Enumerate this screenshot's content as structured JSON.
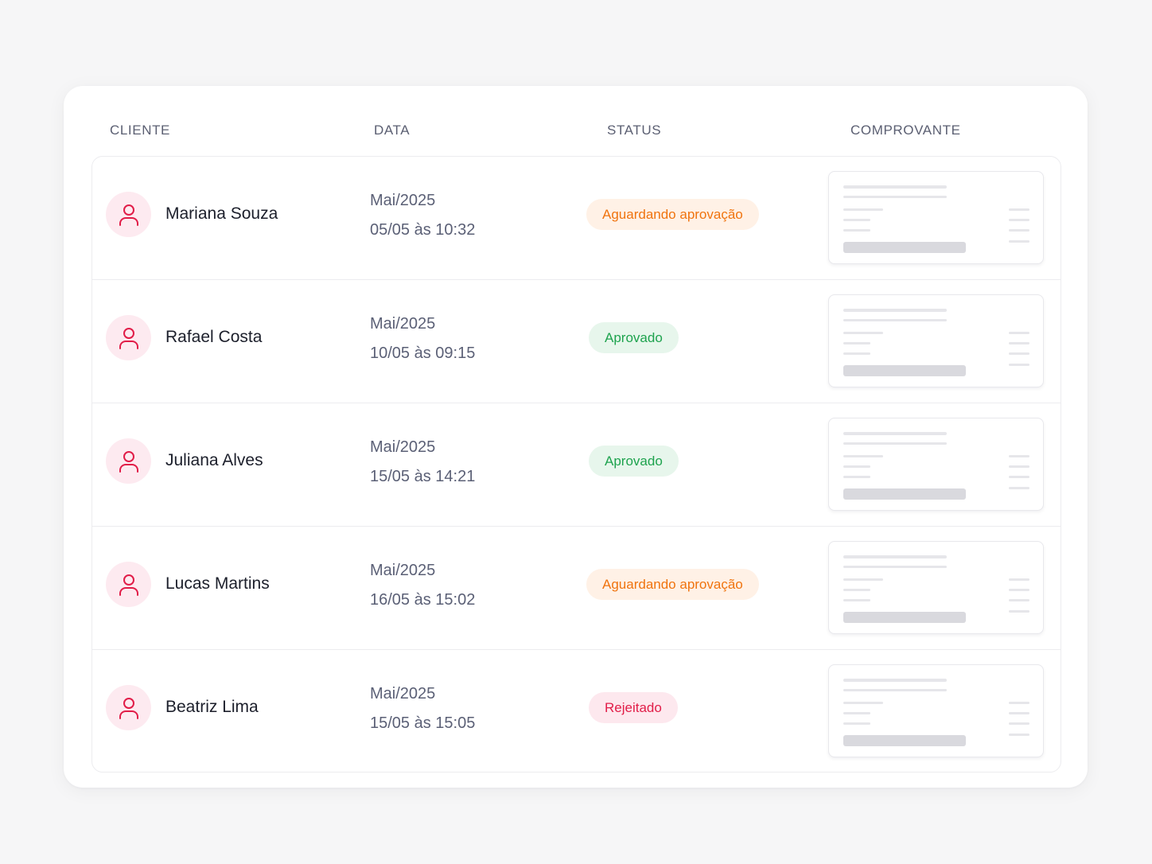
{
  "colors": {
    "accent": "#e11d48",
    "avatar_bg": "#fdeaf0",
    "pending": "#f0740f",
    "pending_bg": "#fff1e6",
    "approved": "#1ea34e",
    "approved_bg": "#e7f6ec",
    "rejected": "#e11d48",
    "rejected_bg": "#fde8ee"
  },
  "table": {
    "headers": {
      "client": "CLIENTE",
      "date": "DATA",
      "status": "STATUS",
      "receipt": "COMPROVANTE"
    },
    "rows": [
      {
        "client": "Mariana Souza",
        "month": "Mai/2025",
        "datetime": "05/05 às 10:32",
        "status": "Aguardando aprovação",
        "status_kind": "pending",
        "avatar_icon": "user-icon",
        "receipt_icon": "receipt-thumbnail"
      },
      {
        "client": "Rafael Costa",
        "month": "Mai/2025",
        "datetime": "10/05 às 09:15",
        "status": "Aprovado",
        "status_kind": "approved",
        "avatar_icon": "user-icon",
        "receipt_icon": "receipt-thumbnail"
      },
      {
        "client": "Juliana Alves",
        "month": "Mai/2025",
        "datetime": "15/05 às 14:21",
        "status": "Aprovado",
        "status_kind": "approved",
        "avatar_icon": "user-icon",
        "receipt_icon": "receipt-thumbnail"
      },
      {
        "client": "Lucas Martins",
        "month": "Mai/2025",
        "datetime": "16/05 às 15:02",
        "status": "Aguardando aprovação",
        "status_kind": "pending",
        "avatar_icon": "user-icon",
        "receipt_icon": "receipt-thumbnail"
      },
      {
        "client": "Beatriz Lima",
        "month": "Mai/2025",
        "datetime": "15/05 às 15:05",
        "status": "Rejeitado",
        "status_kind": "rejected",
        "avatar_icon": "user-icon",
        "receipt_icon": "receipt-thumbnail"
      }
    ]
  }
}
